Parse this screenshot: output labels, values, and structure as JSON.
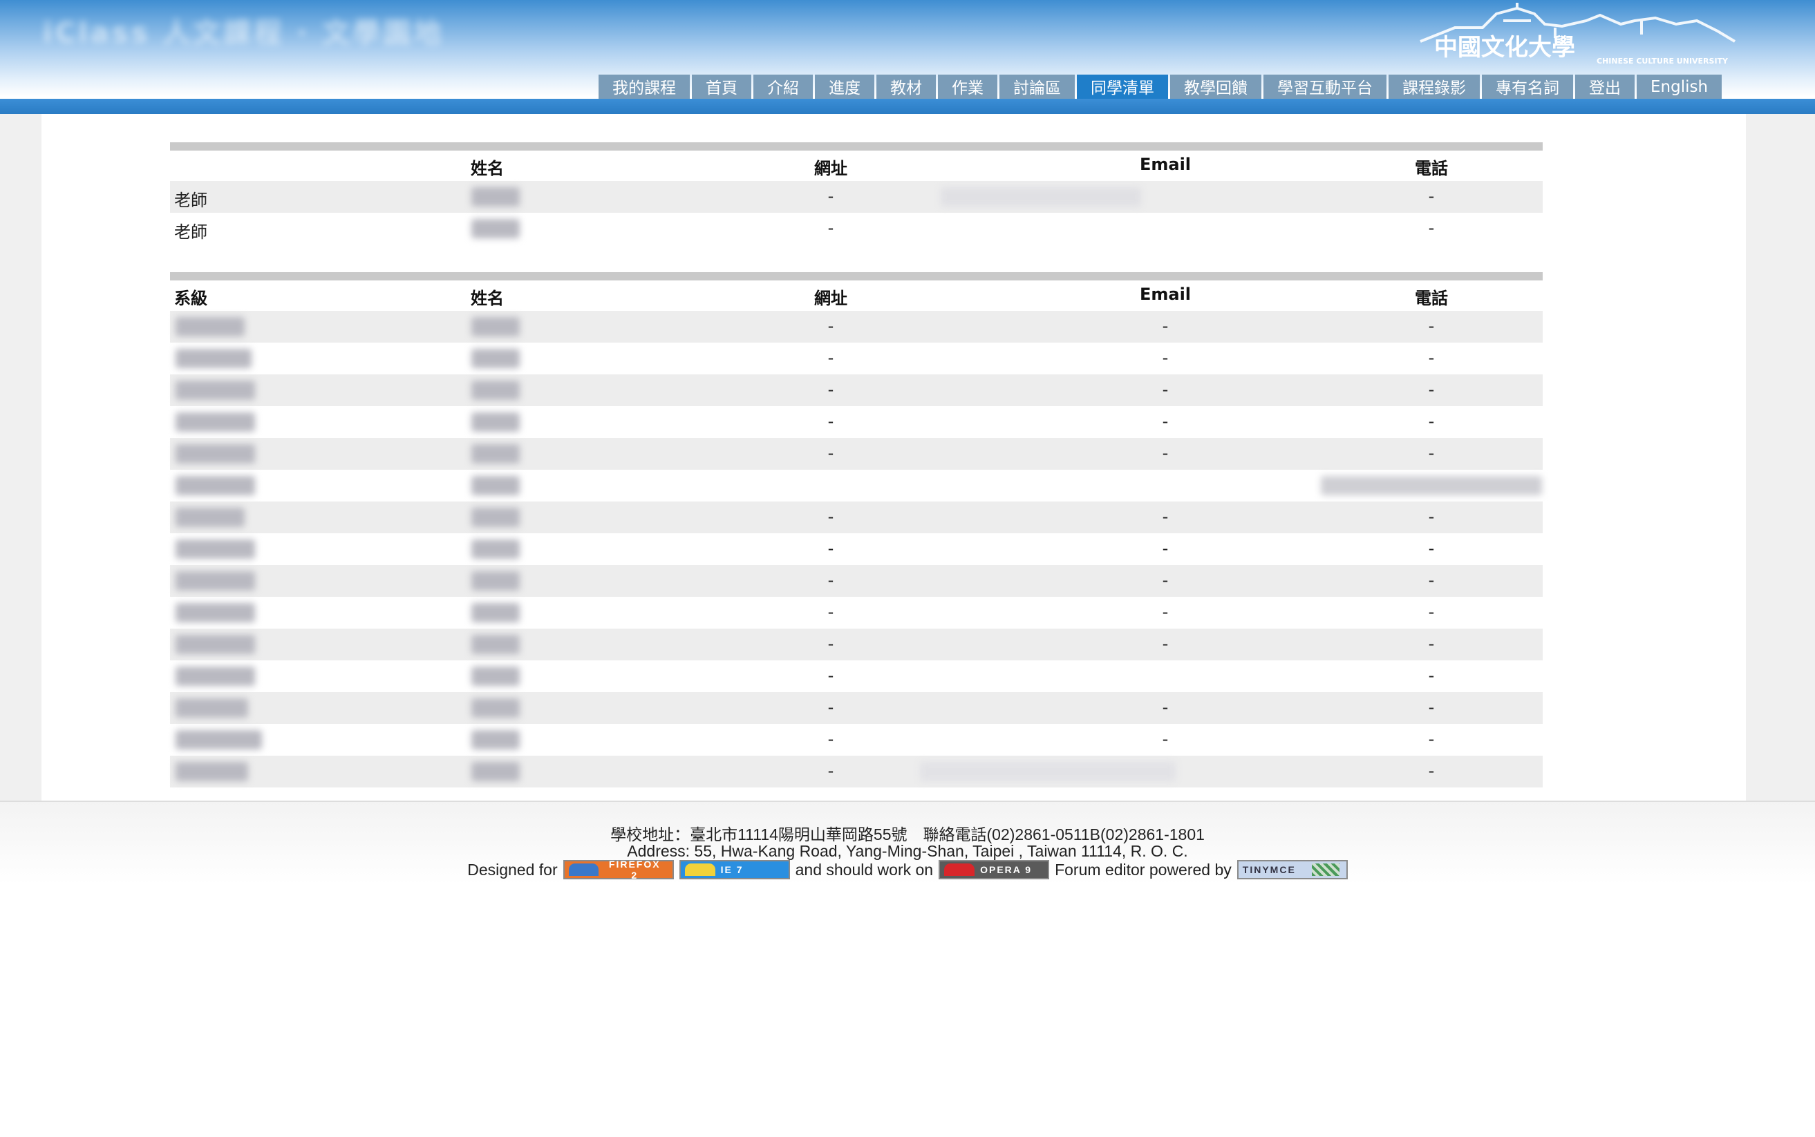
{
  "header": {
    "site_title": "iClass 人文課程 · 文學園地",
    "logo_text": "中國文化大學",
    "logo_subtext": "CHINESE CULTURE UNIVERSITY",
    "nav_tabs": [
      {
        "label": "我的課程",
        "active": false
      },
      {
        "label": "首頁",
        "active": false
      },
      {
        "label": "介紹",
        "active": false
      },
      {
        "label": "進度",
        "active": false
      },
      {
        "label": "教材",
        "active": false
      },
      {
        "label": "作業",
        "active": false
      },
      {
        "label": "討論區",
        "active": false
      },
      {
        "label": "同學清單",
        "active": true
      },
      {
        "label": "教學回饋",
        "active": false
      },
      {
        "label": "學習互動平台",
        "active": false
      },
      {
        "label": "課程錄影",
        "active": false
      },
      {
        "label": "專有名詞",
        "active": false
      },
      {
        "label": "登出",
        "active": false
      },
      {
        "label": "English",
        "active": false
      }
    ]
  },
  "teachers": {
    "headers": {
      "role": "",
      "name": "姓名",
      "url": "網址",
      "email": "Email",
      "phone": "電話"
    },
    "rows": [
      {
        "role": "老師",
        "url": "-",
        "phone": "-"
      },
      {
        "role": "老師",
        "url": "-",
        "phone": "-"
      }
    ]
  },
  "students": {
    "headers": {
      "dept": "系級",
      "name": "姓名",
      "url": "網址",
      "email": "Email",
      "phone": "電話"
    },
    "rows": [
      {
        "url": "-",
        "email": "-",
        "phone": "-"
      },
      {
        "url": "-",
        "email": "-",
        "phone": "-"
      },
      {
        "url": "-",
        "email": "-",
        "phone": "-"
      },
      {
        "url": "-",
        "email": "-",
        "phone": "-"
      },
      {
        "url": "-",
        "email": "-",
        "phone": "-"
      },
      {
        "url": "",
        "email": "",
        "phone": ""
      },
      {
        "url": "-",
        "email": "-",
        "phone": "-"
      },
      {
        "url": "-",
        "email": "-",
        "phone": "-"
      },
      {
        "url": "-",
        "email": "-",
        "phone": "-"
      },
      {
        "url": "-",
        "email": "-",
        "phone": "-"
      },
      {
        "url": "-",
        "email": "-",
        "phone": "-"
      },
      {
        "url": "-",
        "email": "",
        "phone": "-"
      },
      {
        "url": "-",
        "email": "-",
        "phone": "-"
      },
      {
        "url": "-",
        "email": "-",
        "phone": "-"
      },
      {
        "url": "-",
        "email": "",
        "phone": "-"
      }
    ]
  },
  "footer": {
    "address_zh": "學校地址：臺北市11114陽明山華岡路55號　聯絡電話(02)2861-0511B(02)2861-1801",
    "address_en": "Address: 55, Hwa-Kang Road, Yang-Ming-Shan, Taipei , Taiwan 11114, R. O. C.",
    "designed_for": "Designed for",
    "should_work_on": "and should work on",
    "powered_by": "Forum editor powered by",
    "badges": {
      "firefox": "FIREFOX 2",
      "ie": "IE 7",
      "opera": "OPERA 9",
      "tinymce": "TINYMCE"
    }
  },
  "colors": {
    "tab": "#7a9cb8",
    "tab_active": "#1f7ec9",
    "header_bar": "#2a7cc4",
    "row_alt": "#ededed"
  }
}
